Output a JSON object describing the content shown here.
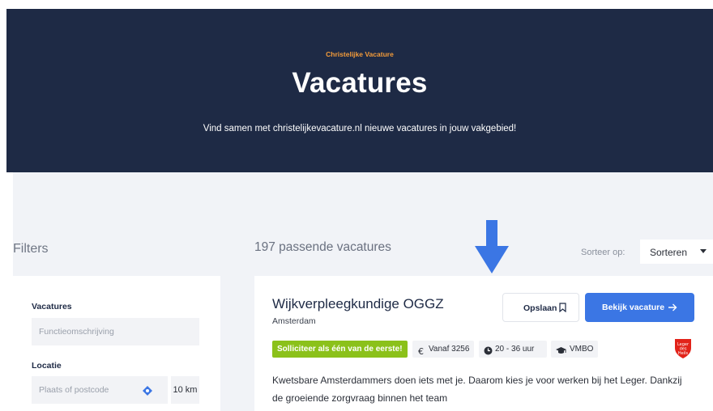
{
  "hero": {
    "eyebrow": "Christelijke Vacature",
    "title": "Vacatures",
    "subtitle": "Vind samen met christelijkevacature.nl nieuwe vacatures in jouw vakgebied!"
  },
  "filters": {
    "title": "Filters",
    "vacatures_label": "Vacatures",
    "function_placeholder": "Functieomschrijving",
    "location_label": "Locatie",
    "location_placeholder": "Plaats of postcode",
    "radius": "10 km"
  },
  "results": {
    "count_text": "197 passende vacatures",
    "sort_label": "Sorteer op:",
    "sort_value": "Sorteren"
  },
  "job": {
    "title": "Wijkverpleegkundige OGGZ",
    "city": "Amsterdam",
    "save_label": "Opslaan",
    "view_label": "Bekijk vacature",
    "apply_tag": "Solliciteer als één van de eerste!",
    "salary": "Vanaf 3256",
    "hours": "20 - 36 uur",
    "education": "VMBO",
    "logo_text": "Leger des Heils",
    "description": "Kwetsbare Amsterdammers doen iets met je. Daarom kies je voor werken bij het Leger. Dankzij de groeiende zorgvraag binnen het team"
  },
  "colors": {
    "hero_bg": "#1e2a45",
    "accent_orange": "#f39b3a",
    "primary_blue": "#3b76e4",
    "tag_green": "#8bc11a",
    "logo_red": "#e2231a"
  },
  "icons": [
    "arrow-down-icon",
    "location-crosshair-icon",
    "bookmark-icon",
    "arrow-right-icon",
    "euro-icon",
    "clock-icon",
    "graduation-cap-icon",
    "caret-down-icon"
  ]
}
